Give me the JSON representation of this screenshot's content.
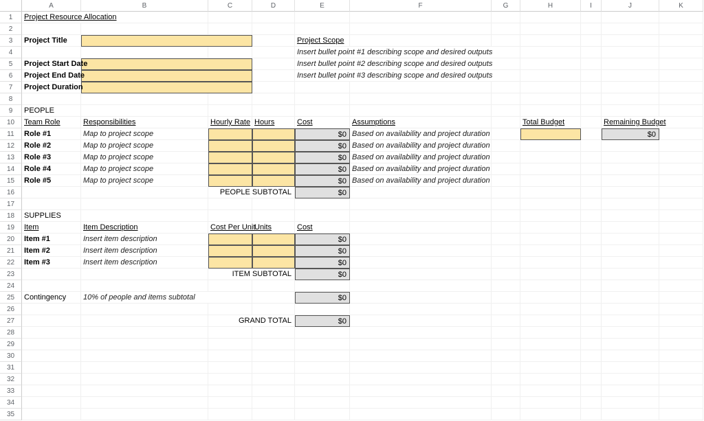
{
  "columns": [
    "A",
    "B",
    "C",
    "D",
    "E",
    "F",
    "G",
    "H",
    "I",
    "J",
    "K"
  ],
  "rowCount": 35,
  "cells": {
    "A1": "Project Resource Allocation",
    "A3": "Project Title",
    "E3": "Project Scope",
    "E4": "Insert bullet point #1 describing scope and desired outputs",
    "A5": "Project Start Date",
    "E5": "Insert bullet point #2 describing scope and desired outputs",
    "A6": "Project End Date",
    "E6": "Insert bullet point #3 describing scope and desired outputs",
    "A7": "Project Duration",
    "A9": "PEOPLE",
    "A10": "Team Role",
    "B10": "Responsibilities",
    "C10": "Hourly Rate",
    "D10": "Hours",
    "E10": "Cost",
    "F10": "Assumptions",
    "H10": "Total Budget",
    "J10": "Remaining Budget",
    "J11": "$0",
    "A11": "Role #1",
    "B11": "Map to project scope",
    "E11": "$0",
    "F11": "Based on availability and project duration",
    "A12": "Role #2",
    "B12": "Map to project scope",
    "E12": "$0",
    "F12": "Based on availability and project duration",
    "A13": "Role #3",
    "B13": "Map to project scope",
    "E13": "$0",
    "F13": "Based on availability and project duration",
    "A14": "Role #4",
    "B14": "Map to project scope",
    "E14": "$0",
    "F14": "Based on availability and project duration",
    "A15": "Role #5",
    "B15": "Map to project scope",
    "E15": "$0",
    "F15": "Based on availability and project duration",
    "D16": "PEOPLE SUBTOTAL",
    "E16": "$0",
    "A18": "SUPPLIES",
    "A19": "Item",
    "B19": "Item Description",
    "C19": "Cost Per Unit",
    "D19": "Units",
    "E19": "Cost",
    "A20": "Item #1",
    "B20": "Insert item description",
    "E20": "$0",
    "A21": "Item #2",
    "B21": "Insert item description",
    "E21": "$0",
    "A22": "Item #3",
    "B22": "Insert item description",
    "E22": "$0",
    "D23": "ITEM SUBTOTAL",
    "E23": "$0",
    "A25": "Contingency",
    "B25": "10% of people and items subtotal",
    "E25": "$0",
    "D27": "GRAND TOTAL",
    "E27": "$0"
  }
}
